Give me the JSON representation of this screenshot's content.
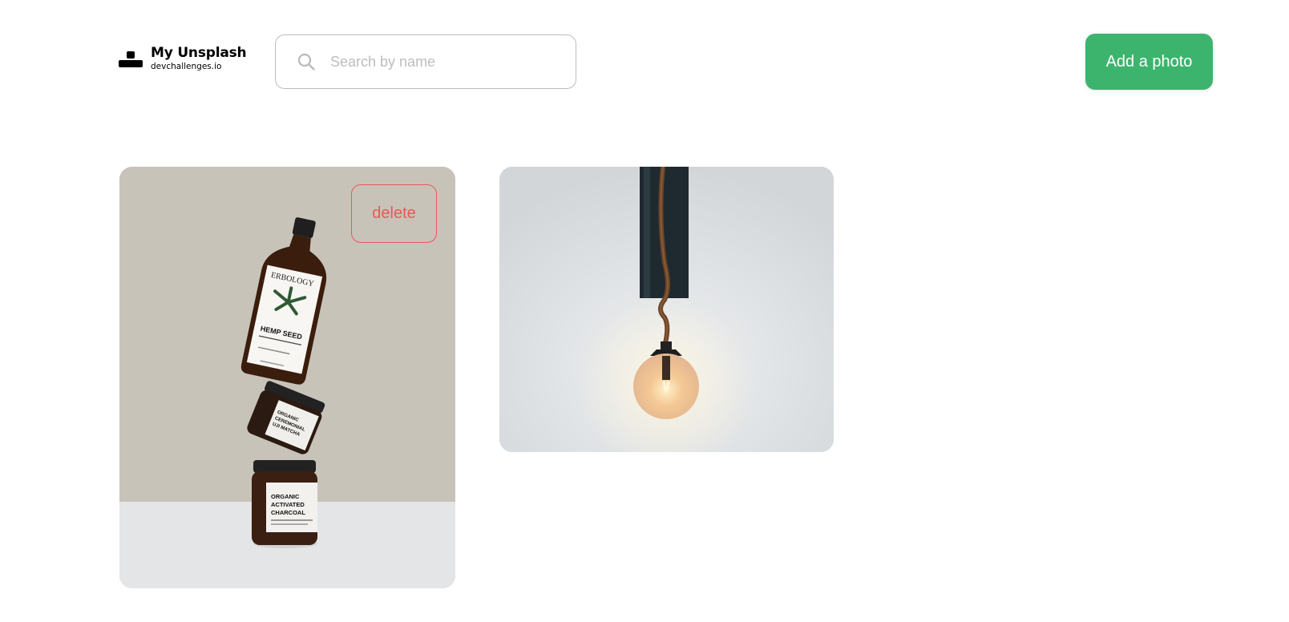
{
  "brand": {
    "title": "My Unsplash",
    "subtitle": "devchallenges.io",
    "icon": "unsplash-logo-icon"
  },
  "search": {
    "placeholder": "Search by name",
    "value": "",
    "icon": "search-icon"
  },
  "actions": {
    "add_label": "Add a photo"
  },
  "photos": [
    {
      "delete_label": "delete",
      "image": "hemp-seed-bottles-photo",
      "bottle_brand": "ERBOLOGY",
      "bottle_name": "HEMP SEED",
      "jar_1": "ORGANIC CEREMONIAL UJI MATCHA",
      "jar_2_lines": [
        "ORGANIC",
        "ACTIVATED",
        "CHARCOAL"
      ]
    },
    {
      "image": "pendant-lamp-photo"
    }
  ],
  "colors": {
    "accent": "#3db46d",
    "danger": "#eb5757",
    "border": "#bdbdbd",
    "placeholder": "#bdbdbd"
  }
}
